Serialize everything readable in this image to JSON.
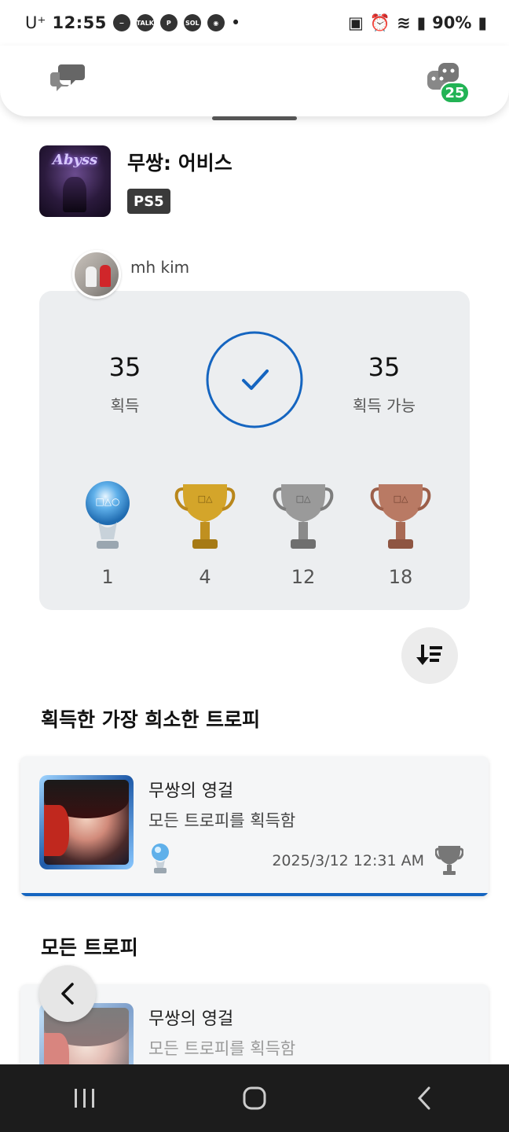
{
  "status_bar": {
    "carrier": "U⁺",
    "time": "12:55",
    "battery": "90%"
  },
  "header": {
    "notification_badge": "25"
  },
  "game": {
    "title": "무쌍: 어비스",
    "cover_logo": "Abyss",
    "platform": "PS5"
  },
  "user": {
    "name": "mh kim"
  },
  "summary": {
    "earned_count": "35",
    "earned_label": "획득",
    "available_count": "35",
    "available_label": "획득 가능",
    "completion": 1.0,
    "trophies": [
      {
        "type": "platinum",
        "count": "1"
      },
      {
        "type": "gold",
        "count": "4"
      },
      {
        "type": "silver",
        "count": "12"
      },
      {
        "type": "bronze",
        "count": "18"
      }
    ]
  },
  "rarest_section": {
    "title": "획득한 가장 희소한 트로피",
    "item": {
      "name": "무쌍의 영걸",
      "description": "모든 트로피를 획득함",
      "trophy_type": "platinum",
      "earned_date": "2025/3/12  12:31 AM"
    }
  },
  "all_section": {
    "title": "모든 트로피",
    "item": {
      "name": "무쌍의 영걸",
      "description": "모든 트로피를 획득함"
    }
  },
  "colors": {
    "accent": "#1565c0",
    "badge": "#22b354",
    "card_bg": "#eceef0",
    "platinum": "#6fb6e8",
    "gold": "#d4a52a",
    "silver": "#9a9a9a",
    "bronze": "#b97a64"
  }
}
